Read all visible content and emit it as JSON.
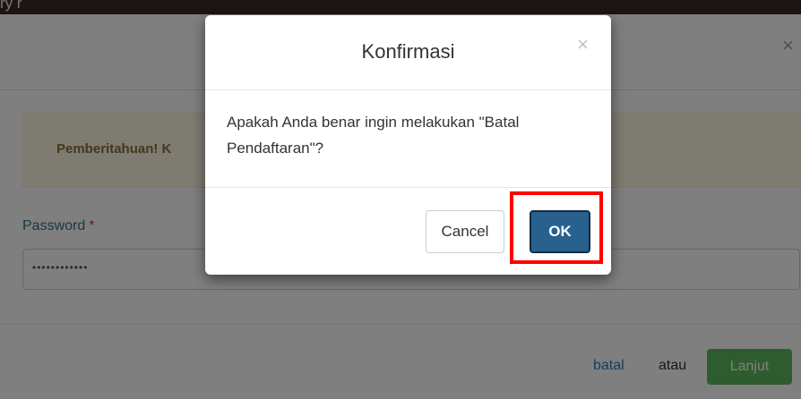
{
  "top_strip": {
    "text": "ry r"
  },
  "background_modal": {
    "close_icon": "×",
    "alert_text": "Pemberitahuan! K",
    "password_label": "Password",
    "required_mark": "*",
    "password_value": "••••••••••••",
    "batal_link": "batal",
    "atau_text": "atau",
    "lanjut_button": "Lanjut"
  },
  "dialog": {
    "title": "Konfirmasi",
    "close_icon": "×",
    "message_line1": "Apakah Anda benar ingin melakukan \"Batal",
    "message_line2": "Pendaftaran\"?",
    "cancel_label": "Cancel",
    "ok_label": "OK"
  },
  "colors": {
    "primary": "#286090",
    "success": "#5cb85c",
    "highlight": "#ff0000",
    "warning_bg": "#fcf8e3"
  }
}
